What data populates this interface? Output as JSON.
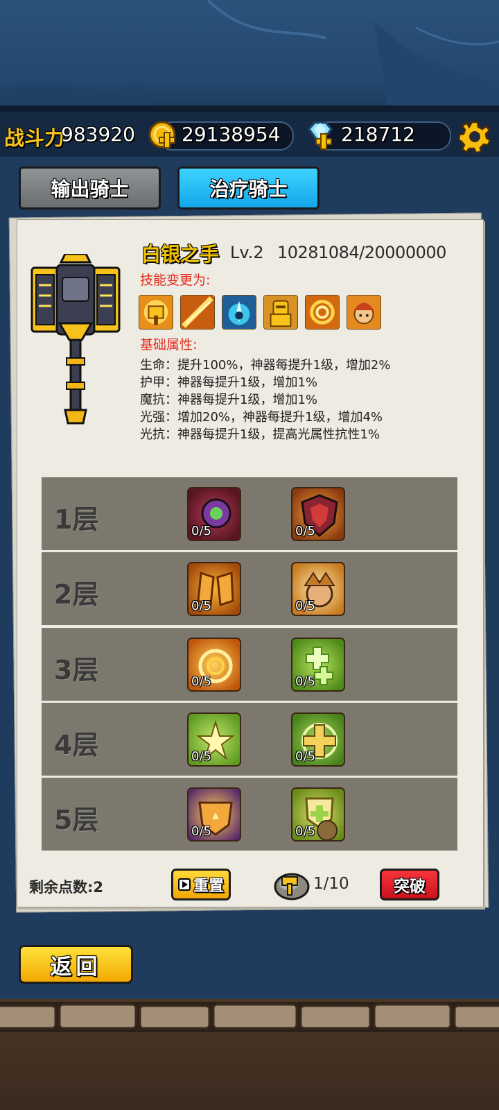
{
  "header": {
    "power_label": "战斗力",
    "power_value": "983920",
    "gold_value": "29138954",
    "gem_value": "218712",
    "icons": [
      "gold-coin-plus-icon",
      "diamond-plus-icon",
      "gear-icon"
    ]
  },
  "tabs": [
    {
      "label": "输出骑士",
      "active": false
    },
    {
      "label": "治疗骑士",
      "active": true
    }
  ],
  "artifact": {
    "name": "白银之手",
    "level": "Lv.2",
    "exp": "10281084/20000000",
    "skills_heading": "技能变更为:",
    "skills": [
      "golden-hammer-skill-icon",
      "flame-slash-skill-icon",
      "ice-burst-skill-icon",
      "golden-knight-skill-icon",
      "fire-vortex-skill-icon",
      "flame-girl-skill-icon"
    ],
    "attributes_heading": "基础属性:",
    "attributes": [
      "生命：提升100%，神器每提升1级，增加2%",
      "护甲：神器每提升1级，增加1%",
      "魔抗：神器每提升1级，增加1%",
      "光强：增加20%，神器每提升1级，增加4%",
      "光抗：神器每提升1级，提高光属性抗性1%"
    ]
  },
  "layers": [
    {
      "label": "1层",
      "talents": [
        {
          "icon": "purple-gauntlet-icon",
          "count": "0/5"
        },
        {
          "icon": "red-shield-icon",
          "count": "0/5"
        }
      ]
    },
    {
      "label": "2层",
      "talents": [
        {
          "icon": "golden-armor-icon",
          "count": "0/5"
        },
        {
          "icon": "spiky-hero-icon",
          "count": "0/5"
        }
      ]
    },
    {
      "label": "3层",
      "talents": [
        {
          "icon": "golden-swirl-icon",
          "count": "0/5"
        },
        {
          "icon": "green-heal-cross-icon",
          "count": "0/5"
        }
      ]
    },
    {
      "label": "4层",
      "talents": [
        {
          "icon": "green-star-burst-icon",
          "count": "0/5"
        },
        {
          "icon": "green-holy-cross-icon",
          "count": "0/5"
        }
      ]
    },
    {
      "label": "5层",
      "talents": [
        {
          "icon": "golden-crown-shield-icon",
          "count": "0/5"
        },
        {
          "icon": "green-shield-buddy-icon",
          "count": "0/5"
        }
      ]
    }
  ],
  "footer": {
    "remaining_points": "剩余点数:2",
    "reset_label": "重置",
    "stone_count": "1/10",
    "breakthrough_label": "突破",
    "back_label": "返回"
  }
}
